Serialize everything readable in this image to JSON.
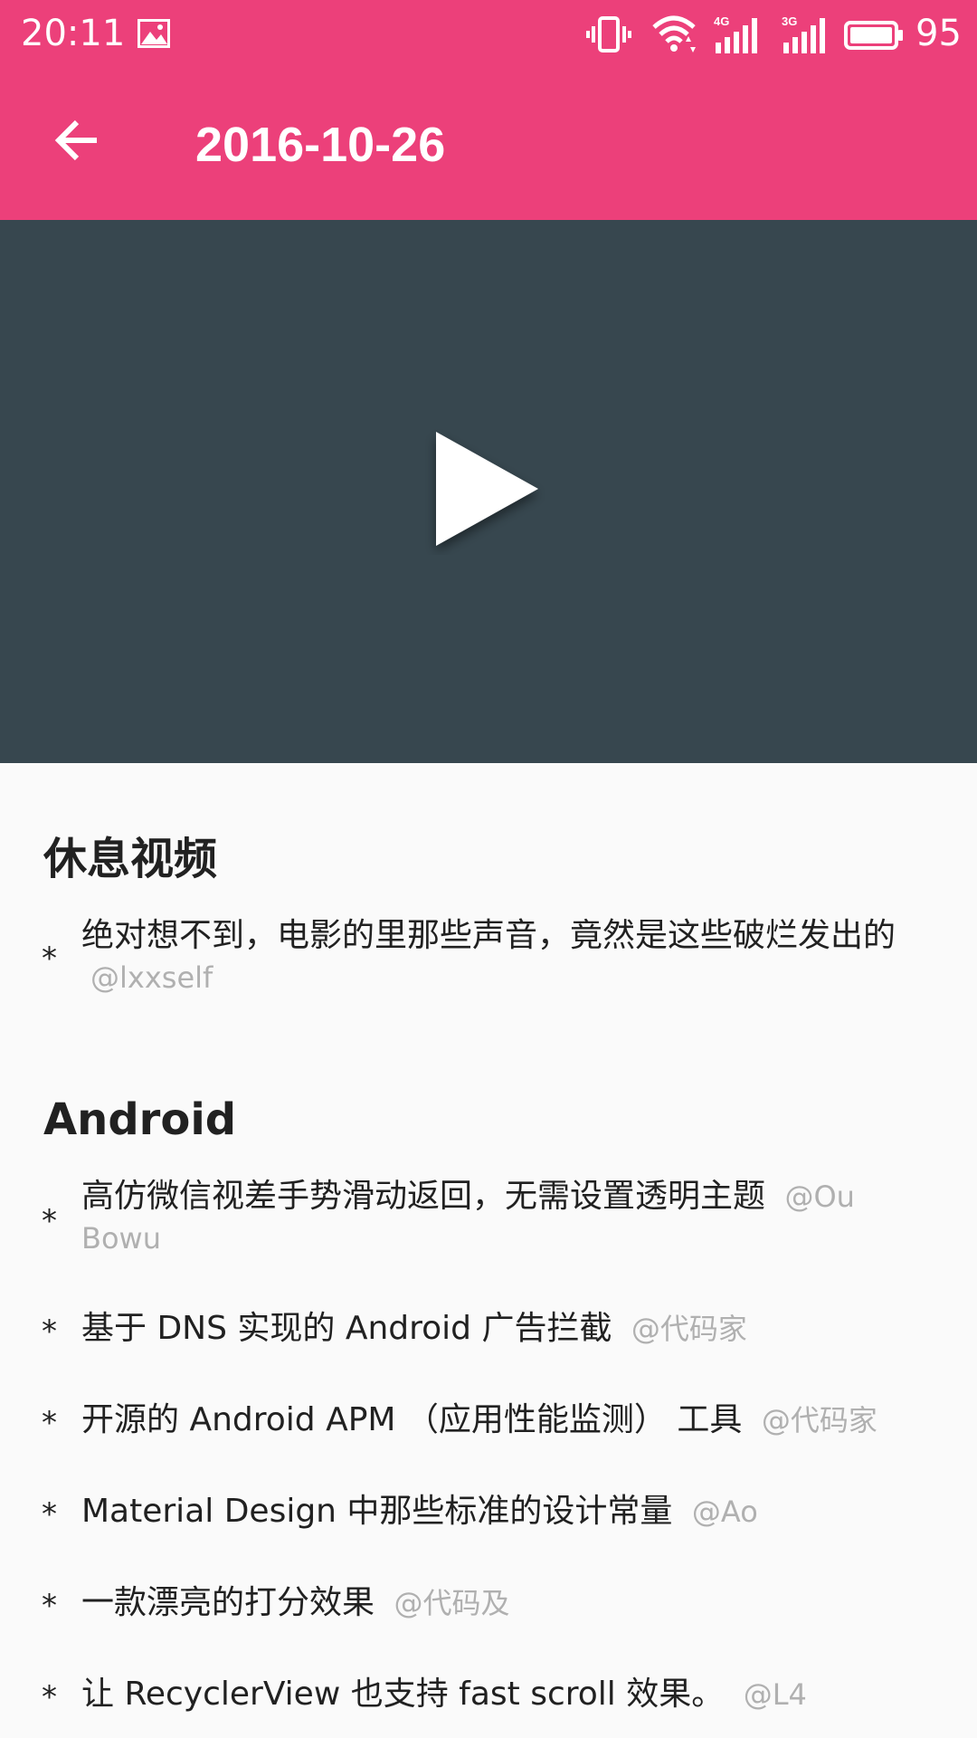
{
  "status_bar": {
    "time": "20:11",
    "battery_level": "95",
    "icons": [
      "gallery-icon",
      "vibrate-icon",
      "wifi-icon",
      "signal-4g-icon",
      "signal-3g-icon",
      "battery-icon"
    ]
  },
  "app_bar": {
    "title": "2016-10-26",
    "back_icon": "arrow-back-icon"
  },
  "video": {
    "play_icon": "play-icon"
  },
  "sections": [
    {
      "title": "休息视频",
      "items": [
        {
          "text": "绝对想不到，电影的里那些声音，竟然是这些破烂发出的",
          "author": "@lxxself"
        }
      ]
    },
    {
      "title": "Android",
      "items": [
        {
          "text": "高仿微信视差手势滑动返回，无需设置透明主题",
          "author": "@Ou Bowu"
        },
        {
          "text": "基于 DNS 实现的 Android 广告拦截",
          "author": "@代码家"
        },
        {
          "text": "开源的 Android APM （应用性能监测） 工具",
          "author": "@代码家"
        },
        {
          "text": "Material Design 中那些标准的设计常量",
          "author": "@Ao"
        },
        {
          "text": "一款漂亮的打分效果",
          "author": "@代码及"
        },
        {
          "text": "让 RecyclerView 也支持 fast scroll 效果。",
          "author": "@L4"
        }
      ]
    }
  ],
  "colors": {
    "primary": "#ec407a",
    "video_bg": "#37474f",
    "background": "#fafafa",
    "text": "#212121",
    "author": "#b0b0b0"
  }
}
